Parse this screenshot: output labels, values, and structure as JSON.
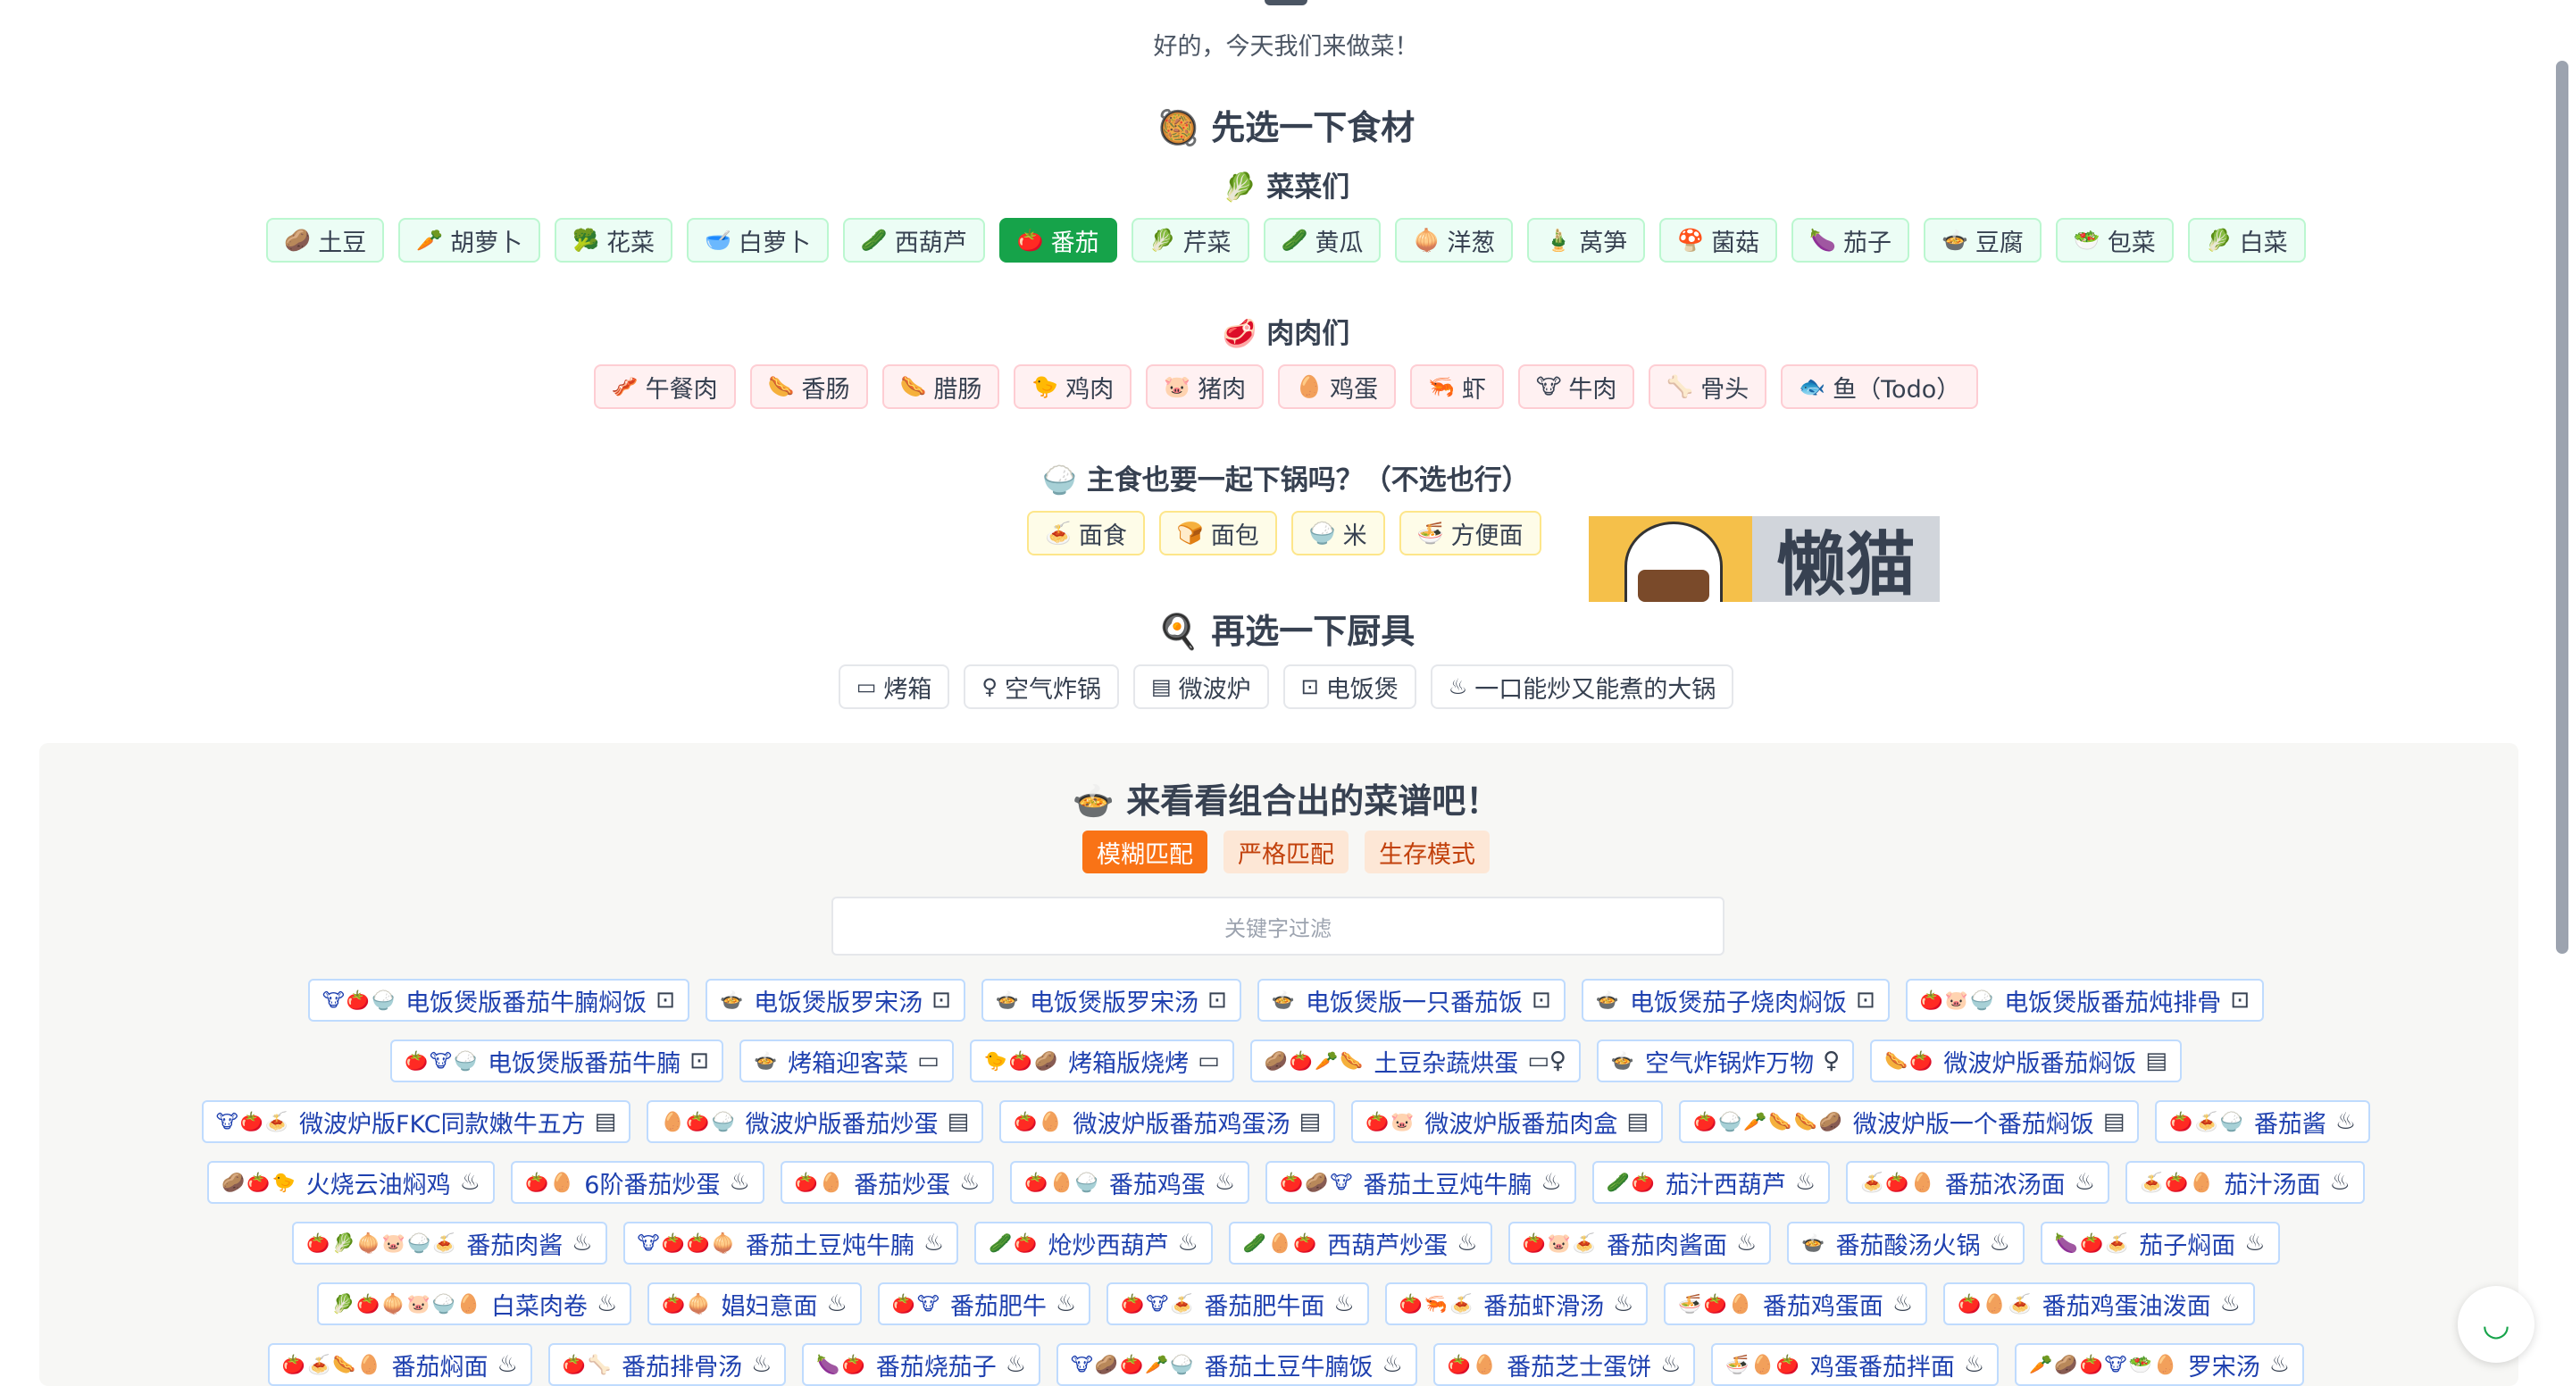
{
  "greeting": "好的，今天我们来做菜！",
  "sections": {
    "ingredients_title": "先选一下食材",
    "ingredients_icon": "🥘",
    "veg_title": "菜菜们",
    "veg_icon": "🥬",
    "meat_title": "肉肉们",
    "meat_icon": "🥩",
    "staple_title": "主食也要一起下锅吗？（不选也行）",
    "staple_icon": "🍚",
    "tools_title": "再选一下厨具",
    "tools_icon": "🍳",
    "results_title": "来看看组合出的菜谱吧！",
    "results_icon": "🍲"
  },
  "vegetables": [
    {
      "icon": "🥔",
      "label": "土豆",
      "active": false
    },
    {
      "icon": "🥕",
      "label": "胡萝卜",
      "active": false
    },
    {
      "icon": "🥦",
      "label": "花菜",
      "active": false
    },
    {
      "icon": "🥣",
      "label": "白萝卜",
      "active": false
    },
    {
      "icon": "🥒",
      "label": "西葫芦",
      "active": false
    },
    {
      "icon": "🍅",
      "label": "番茄",
      "active": true
    },
    {
      "icon": "🥬",
      "label": "芹菜",
      "active": false
    },
    {
      "icon": "🥒",
      "label": "黄瓜",
      "active": false
    },
    {
      "icon": "🧅",
      "label": "洋葱",
      "active": false
    },
    {
      "icon": "🎍",
      "label": "莴笋",
      "active": false
    },
    {
      "icon": "🍄",
      "label": "菌菇",
      "active": false
    },
    {
      "icon": "🍆",
      "label": "茄子",
      "active": false
    },
    {
      "icon": "🍲",
      "label": "豆腐",
      "active": false
    },
    {
      "icon": "🥗",
      "label": "包菜",
      "active": false
    },
    {
      "icon": "🥬",
      "label": "白菜",
      "active": false
    }
  ],
  "meats": [
    {
      "icon": "🥓",
      "label": "午餐肉"
    },
    {
      "icon": "🌭",
      "label": "香肠"
    },
    {
      "icon": "🌭",
      "label": "腊肠"
    },
    {
      "icon": "🐤",
      "label": "鸡肉"
    },
    {
      "icon": "🐷",
      "label": "猪肉"
    },
    {
      "icon": "🥚",
      "label": "鸡蛋"
    },
    {
      "icon": "🦐",
      "label": "虾"
    },
    {
      "icon": "🐮",
      "label": "牛肉"
    },
    {
      "icon": "🦴",
      "label": "骨头"
    },
    {
      "icon": "🐟",
      "label": "鱼（Todo）"
    }
  ],
  "staples": [
    {
      "icon": "🍝",
      "label": "面食"
    },
    {
      "icon": "🍞",
      "label": "面包"
    },
    {
      "icon": "🍚",
      "label": "米"
    },
    {
      "icon": "🍜",
      "label": "方便面"
    }
  ],
  "banner_text": "懒猫",
  "tools": [
    {
      "icon": "▭",
      "label": "烤箱"
    },
    {
      "icon": "♀",
      "label": "空气炸锅"
    },
    {
      "icon": "▤",
      "label": "微波炉"
    },
    {
      "icon": "⊡",
      "label": "电饭煲"
    },
    {
      "icon": "♨",
      "label": "一口能炒又能煮的大锅"
    }
  ],
  "modes": [
    {
      "label": "模糊匹配",
      "active": true
    },
    {
      "label": "严格匹配",
      "active": false
    },
    {
      "label": "生存模式",
      "active": false
    }
  ],
  "search": {
    "placeholder": "关键字过滤"
  },
  "recipes": [
    [
      {
        "emoji": "🐮🍅🍚",
        "name": "电饭煲版番茄牛腩焖饭",
        "tool": "⊡"
      },
      {
        "emoji": "🍲",
        "name": "电饭煲版罗宋汤",
        "tool": "⊡"
      },
      {
        "emoji": "🍲",
        "name": "电饭煲版罗宋汤",
        "tool": "⊡"
      },
      {
        "emoji": "🍲",
        "name": "电饭煲版一只番茄饭",
        "tool": "⊡"
      },
      {
        "emoji": "🍲",
        "name": "电饭煲茄子烧肉焖饭",
        "tool": "⊡"
      },
      {
        "emoji": "🍅🐷🍚",
        "name": "电饭煲版番茄炖排骨",
        "tool": "⊡"
      }
    ],
    [
      {
        "emoji": "🍅🐮🍚",
        "name": "电饭煲版番茄牛腩",
        "tool": "⊡"
      },
      {
        "emoji": "🍲",
        "name": "烤箱迎客菜",
        "tool": "▭"
      },
      {
        "emoji": "🐤🍅🥔",
        "name": "烤箱版烧烤",
        "tool": "▭"
      },
      {
        "emoji": "🥔🍅🥕🌭",
        "name": "土豆杂蔬烘蛋",
        "tool": "▭♀"
      },
      {
        "emoji": "🍲",
        "name": "空气炸锅炸万物",
        "tool": "♀"
      },
      {
        "emoji": "🌭🍅",
        "name": "微波炉版番茄焖饭",
        "tool": "▤"
      }
    ],
    [
      {
        "emoji": "🐮🍅🍝",
        "name": "微波炉版FKC同款嫩牛五方",
        "tool": "▤"
      },
      {
        "emoji": "🥚🍅🍚",
        "name": "微波炉版番茄炒蛋",
        "tool": "▤"
      },
      {
        "emoji": "🍅🥚",
        "name": "微波炉版番茄鸡蛋汤",
        "tool": "▤"
      },
      {
        "emoji": "🍅🐷",
        "name": "微波炉版番茄肉盒",
        "tool": "▤"
      },
      {
        "emoji": "🍅🍚🥕🌭🌭🥔",
        "name": "微波炉版一个番茄焖饭",
        "tool": "▤"
      },
      {
        "emoji": "🍅🍝🍚",
        "name": "番茄酱",
        "tool": "♨"
      }
    ],
    [
      {
        "emoji": "🥔🍅🐤",
        "name": "火烧云油焖鸡",
        "tool": "♨"
      },
      {
        "emoji": "🍅🥚",
        "name": "6阶番茄炒蛋",
        "tool": "♨"
      },
      {
        "emoji": "🍅🥚",
        "name": "番茄炒蛋",
        "tool": "♨"
      },
      {
        "emoji": "🍅🥚🍚",
        "name": "番茄鸡蛋",
        "tool": "♨"
      },
      {
        "emoji": "🍅🥔🐮",
        "name": "番茄土豆炖牛腩",
        "tool": "♨"
      },
      {
        "emoji": "🥒🍅",
        "name": "茄汁西葫芦",
        "tool": "♨"
      },
      {
        "emoji": "🍝🍅🥚",
        "name": "番茄浓汤面",
        "tool": "♨"
      },
      {
        "emoji": "🍝🍅🥚",
        "name": "茄汁汤面",
        "tool": "♨"
      }
    ],
    [
      {
        "emoji": "🍅🥬🧅🐷🍚🍝",
        "name": "番茄肉酱",
        "tool": "♨"
      },
      {
        "emoji": "🐮🍅🍅🧅",
        "name": "番茄土豆炖牛腩",
        "tool": "♨"
      },
      {
        "emoji": "🥒🍅",
        "name": "炝炒西葫芦",
        "tool": "♨"
      },
      {
        "emoji": "🥒🥚🍅",
        "name": "西葫芦炒蛋",
        "tool": "♨"
      },
      {
        "emoji": "🍅🐷🍝",
        "name": "番茄肉酱面",
        "tool": "♨"
      },
      {
        "emoji": "🍲",
        "name": "番茄酸汤火锅",
        "tool": "♨"
      },
      {
        "emoji": "🍆🍅🍝",
        "name": "茄子焖面",
        "tool": "♨"
      }
    ],
    [
      {
        "emoji": "🥬🍅🧅🐷🍚🥚",
        "name": "白菜肉卷",
        "tool": "♨"
      },
      {
        "emoji": "🍅🧅",
        "name": "娼妇意面",
        "tool": "♨"
      },
      {
        "emoji": "🍅🐮",
        "name": "番茄肥牛",
        "tool": "♨"
      },
      {
        "emoji": "🍅🐮🍝",
        "name": "番茄肥牛面",
        "tool": "♨"
      },
      {
        "emoji": "🍅🦐🍝",
        "name": "番茄虾滑汤",
        "tool": "♨"
      },
      {
        "emoji": "🍜🍅🥚",
        "name": "番茄鸡蛋面",
        "tool": "♨"
      },
      {
        "emoji": "🍅🥚🍝",
        "name": "番茄鸡蛋油泼面",
        "tool": "♨"
      }
    ],
    [
      {
        "emoji": "🍅🍝🌭🥚",
        "name": "番茄焖面",
        "tool": "♨"
      },
      {
        "emoji": "🍅🦴",
        "name": "番茄排骨汤",
        "tool": "♨"
      },
      {
        "emoji": "🍆🍅",
        "name": "番茄烧茄子",
        "tool": "♨"
      },
      {
        "emoji": "🐮🥔🍅🥕🍚",
        "name": "番茄土豆牛腩饭",
        "tool": "♨"
      },
      {
        "emoji": "🍅🥚",
        "name": "番茄芝士蛋饼",
        "tool": "♨"
      },
      {
        "emoji": "🍜🥚🍅",
        "name": "鸡蛋番茄拌面",
        "tool": "♨"
      },
      {
        "emoji": "🥕🥔🍅🐮🥗🥚",
        "name": "罗宋汤",
        "tool": "♨"
      }
    ]
  ],
  "colors": {
    "accent_green": "#16a34a",
    "accent_orange": "#f97316",
    "recipe_text": "#1e40af"
  },
  "fab_icon": "bowl-icon"
}
